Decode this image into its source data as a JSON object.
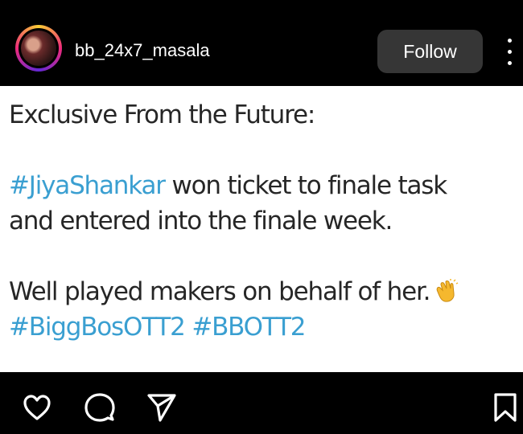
{
  "header": {
    "username": "bb_24x7_masala",
    "follow_label": "Follow"
  },
  "post": {
    "line1": "Exclusive From the Future:",
    "line2_tag": "#JiyaShankar",
    "line2_rest": " won ticket to finale task",
    "line3": "and entered into the finale week.",
    "line4": "Well played makers on behalf of her.",
    "line5_tag1": "#BiggBosOTT2",
    "line5_tag2": "#BBOTT2",
    "emoji": "clapping-hands-icon"
  },
  "colors": {
    "hashtag": "#3a9fd1",
    "follow_bg": "#363636",
    "text": "#262626"
  },
  "icons": [
    "heart-icon",
    "comment-icon",
    "share-icon",
    "bookmark-icon",
    "more-icon"
  ]
}
